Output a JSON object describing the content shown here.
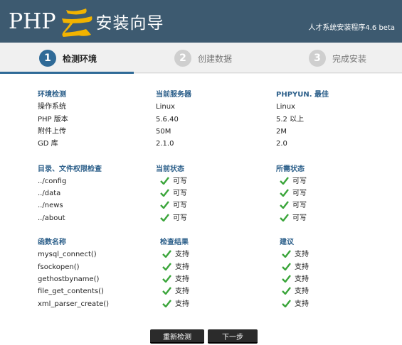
{
  "header": {
    "logo_text": "PHP",
    "title": "安装向导",
    "version": "人才系统安装程序4.6 beta",
    "accent_color": "#f2b300"
  },
  "steps": [
    {
      "num": "1",
      "label": "检测环境",
      "active": true
    },
    {
      "num": "2",
      "label": "创建数据",
      "active": false
    },
    {
      "num": "3",
      "label": "完成安装",
      "active": false
    }
  ],
  "env": {
    "headers": [
      "环境检测",
      "当前服务器",
      "PHPYUN. 最佳"
    ],
    "rows": [
      [
        "操作系统",
        "Linux",
        "Linux"
      ],
      [
        "PHP 版本",
        "5.6.40",
        "5.2 以上"
      ],
      [
        "附件上传",
        "50M",
        "2M"
      ],
      [
        "GD 库",
        "2.1.0",
        "2.0"
      ]
    ]
  },
  "dirs": {
    "headers": [
      "目录、文件权限检查",
      "当前状态",
      "所需状态"
    ],
    "rows": [
      [
        "../config",
        "可写",
        "可写"
      ],
      [
        "../data",
        "可写",
        "可写"
      ],
      [
        "../news",
        "可写",
        "可写"
      ],
      [
        "../about",
        "可写",
        "可写"
      ]
    ]
  },
  "funcs": {
    "headers": [
      "函数名称",
      "检查结果",
      "建议"
    ],
    "rows": [
      [
        "mysql_connect()",
        "支持",
        "支持"
      ],
      [
        "fsockopen()",
        "支持",
        "支持"
      ],
      [
        "gethostbyname()",
        "支持",
        "支持"
      ],
      [
        "file_get_contents()",
        "支持",
        "支持"
      ],
      [
        "xml_parser_create()",
        "支持",
        "支持"
      ]
    ]
  },
  "buttons": {
    "recheck": "重新检测",
    "next": "下一步"
  },
  "icons": {
    "status": "check-icon",
    "check_color": "#3aa53a"
  }
}
